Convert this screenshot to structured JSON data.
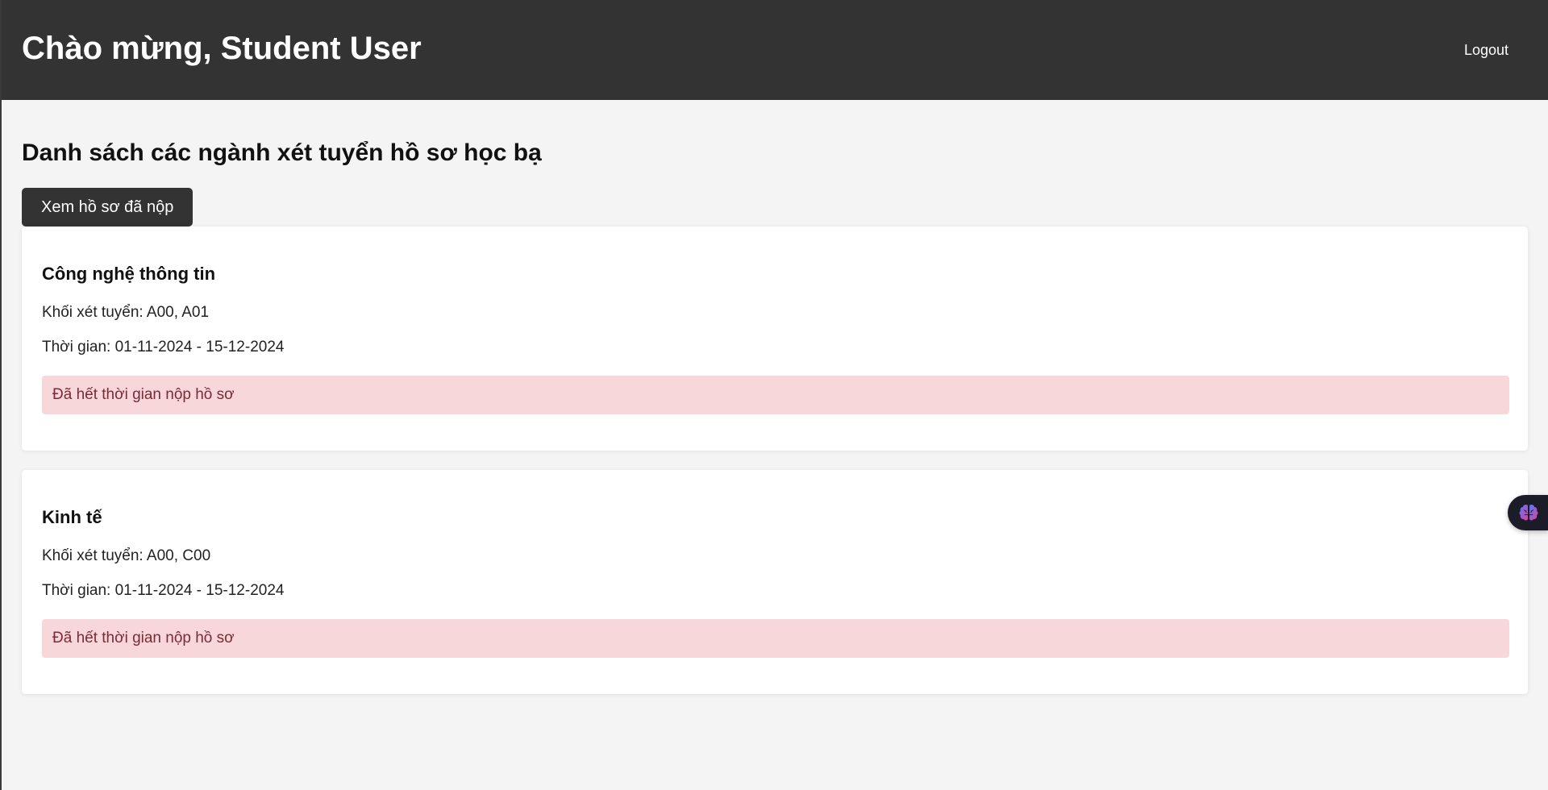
{
  "header": {
    "greeting": "Chào mừng, Student User",
    "logout_label": "Logout"
  },
  "main": {
    "title": "Danh sách các ngành xét tuyển hồ sơ học bạ",
    "view_submissions_label": "Xem hồ sơ đã nộp",
    "majors": [
      {
        "name": "Công nghệ thông tin",
        "blocks": "Khối xét tuyển: A00, A01",
        "time": "Thời gian: 01-11-2024 - 15-12-2024",
        "status": "Đã hết thời gian nộp hồ sơ"
      },
      {
        "name": "Kinh tế",
        "blocks": "Khối xét tuyển: A00, C00",
        "time": "Thời gian: 01-11-2024 - 15-12-2024",
        "status": "Đã hết thời gian nộp hồ sơ"
      }
    ]
  },
  "widget": {
    "icon": "brain-icon"
  },
  "colors": {
    "header_bg": "#333333",
    "page_bg": "#f4f4f4",
    "alert_bg": "#f7d7da",
    "alert_text": "#7a2b35"
  }
}
